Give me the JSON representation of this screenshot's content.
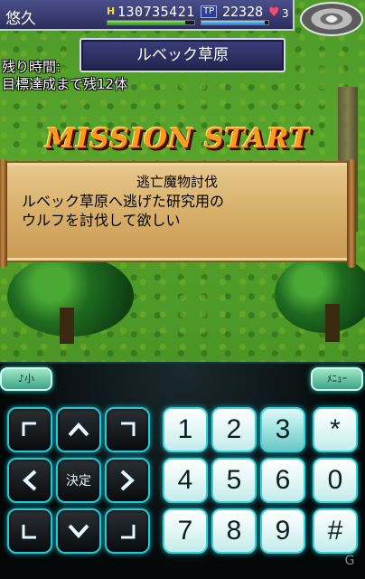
{
  "status": {
    "player_name": "悠久",
    "hp_icon": "H",
    "hp_value": "130735421",
    "hp_fill": 0.9,
    "tp_label": "TP",
    "tp_value": "22328",
    "tp_fill": 0.95,
    "hearts": "3"
  },
  "location": "ルベック草原",
  "timer_label": "残り時間:",
  "goal_text": "目標達成まで残12体",
  "banner": "MISSION START",
  "mission": {
    "title": "逃亡魔物討伐",
    "description_line1": "ルベック草原へ逃げた研究用の",
    "description_line2": "ウルフを討伐して欲しい"
  },
  "controller": {
    "soft_left": "♪小",
    "soft_right": "ﾒﾆｭｰ",
    "center_label": "決定",
    "numbers": [
      "1",
      "2",
      "3",
      "*",
      "4",
      "5",
      "6",
      "0",
      "7",
      "8",
      "9",
      "#"
    ]
  },
  "watermark": "G"
}
